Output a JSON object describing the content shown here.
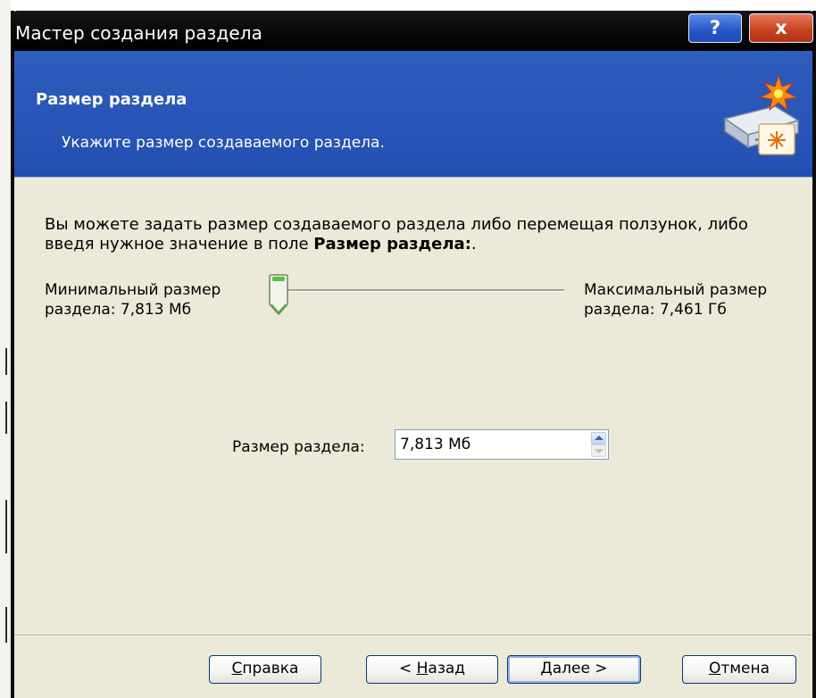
{
  "window": {
    "title": "Мастер создания раздела",
    "help_glyph": "?",
    "close_glyph": "x"
  },
  "header": {
    "title": "Размер раздела",
    "subtitle": "Укажите размер создаваемого раздела."
  },
  "content": {
    "description_part1": "Вы можете задать размер создаваемого раздела либо перемещая ползунок, либо введя нужное значение в поле ",
    "description_bold": "Размер раздела:",
    "description_end": ".",
    "min_label_line1": "Минимальный размер",
    "min_label_line2": "раздела: 7,813 Мб",
    "max_label_line1": "Максимальный размер",
    "max_label_line2": "раздела: 7,461 Гб",
    "slider_fraction": 0,
    "size_label": "Размер раздела:",
    "size_value": "7,813 Мб"
  },
  "buttons": {
    "help_accel": "С",
    "help_rest": "правка",
    "back_prefix": "< ",
    "back_accel": "Н",
    "back_rest": "азад",
    "next_accel": "Д",
    "next_rest": "алее >",
    "cancel_accel": "О",
    "cancel_rest": "тмена"
  },
  "colors": {
    "header_blue": "#2a57b8",
    "dialog_bg": "#ece9d8",
    "close_red": "#c7401d"
  }
}
